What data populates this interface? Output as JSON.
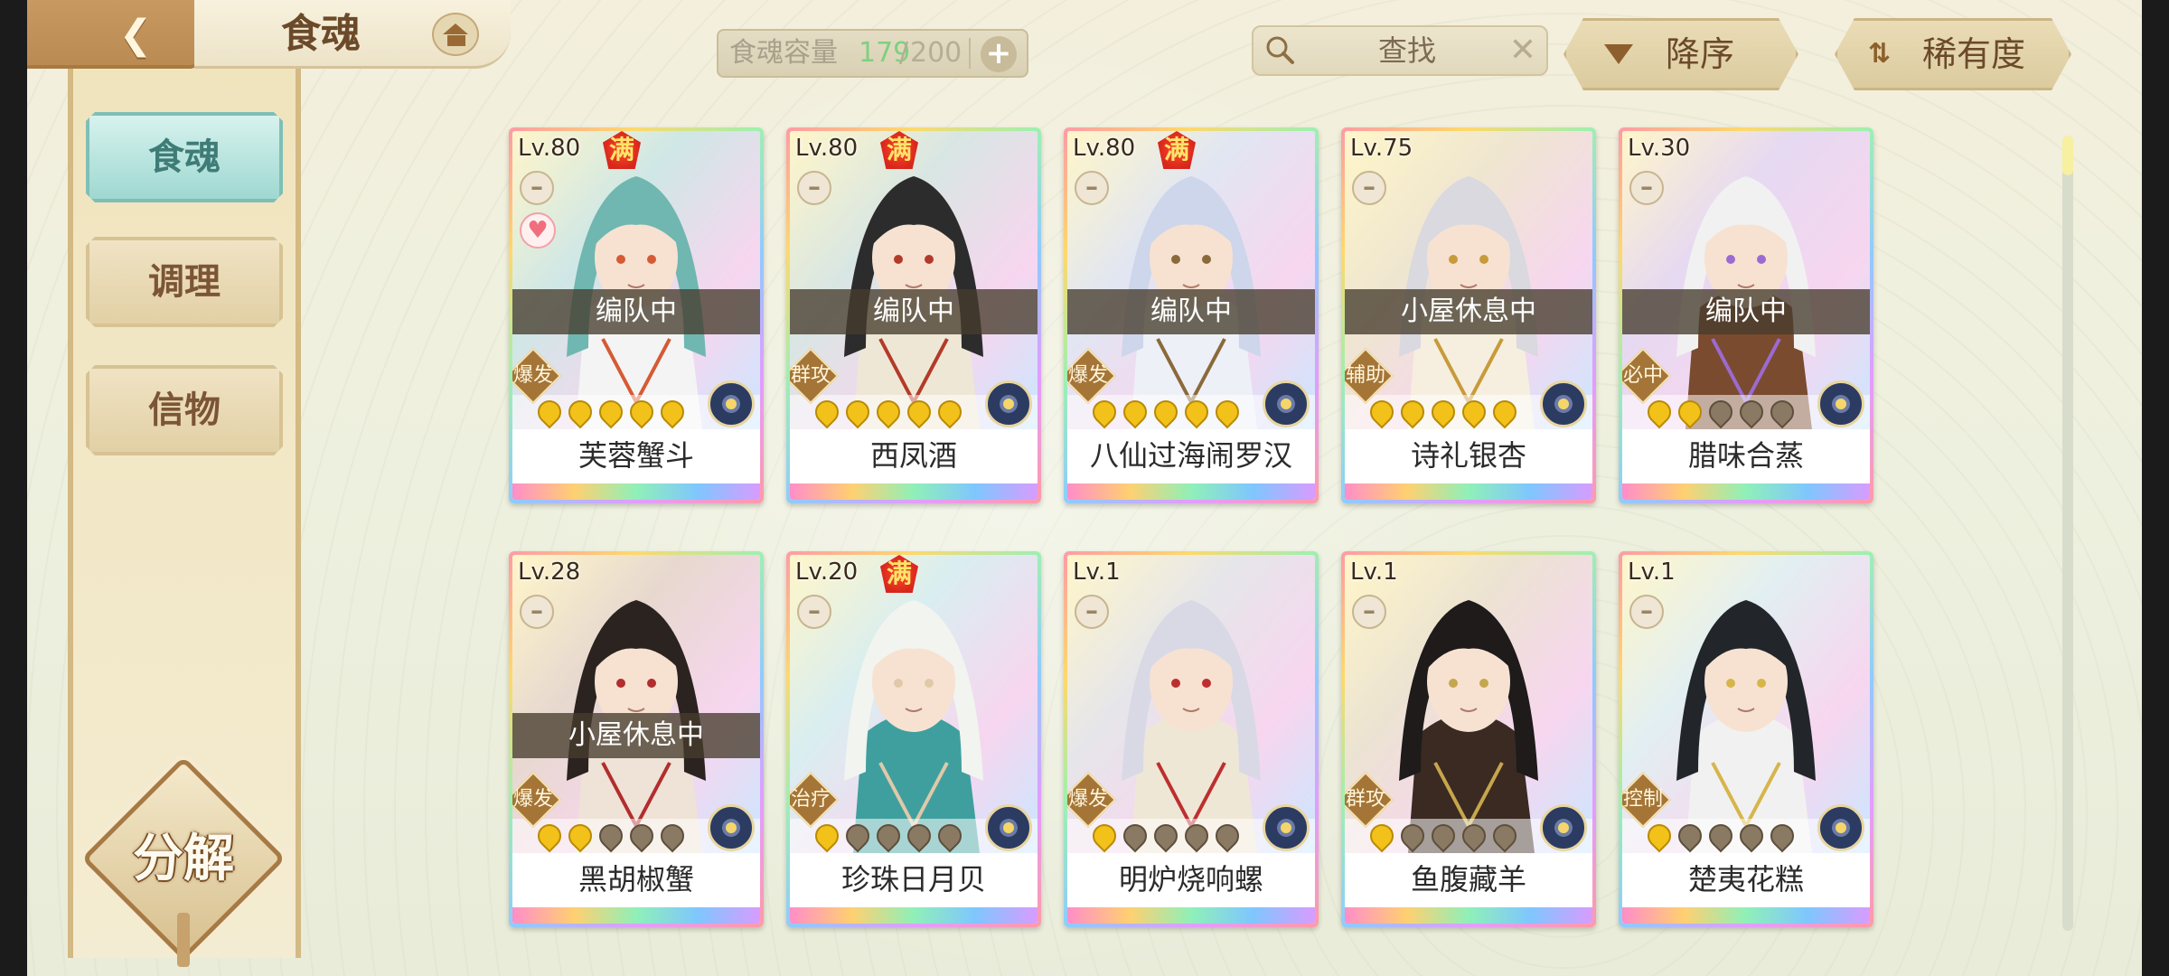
{
  "header": {
    "title": "食魂",
    "capacity": {
      "label": "食魂容量",
      "current": "179",
      "separator": "/",
      "max": "200"
    },
    "search": {
      "placeholder": "查找"
    },
    "sort_order": "降序",
    "sort_key": "稀有度"
  },
  "sidebar": {
    "items": [
      {
        "label": "食魂",
        "active": true
      },
      {
        "label": "调理",
        "active": false
      },
      {
        "label": "信物",
        "active": false
      }
    ],
    "decompose_label": "分解"
  },
  "colors": {
    "accent_teal": "#9fd8d1",
    "gold": "#a47537",
    "background": "#eef0df"
  },
  "cards": [
    {
      "level": "Lv.80",
      "full": "满",
      "status": "编队中",
      "role": "爆发",
      "stars": 5,
      "name": "芙蓉蟹斗",
      "favorite": true
    },
    {
      "level": "Lv.80",
      "full": "满",
      "status": "编队中",
      "role": "群攻",
      "stars": 5,
      "name": "西凤酒",
      "favorite": false
    },
    {
      "level": "Lv.80",
      "full": "满",
      "status": "编队中",
      "role": "爆发",
      "stars": 5,
      "name": "八仙过海闹罗汉",
      "favorite": false
    },
    {
      "level": "Lv.75",
      "full": "",
      "status": "小屋休息中",
      "role": "辅助",
      "stars": 5,
      "name": "诗礼银杏",
      "favorite": false
    },
    {
      "level": "Lv.30",
      "full": "",
      "status": "编队中",
      "role": "必中",
      "stars": 2,
      "name": "腊味合蒸",
      "favorite": false
    },
    {
      "level": "Lv.28",
      "full": "",
      "status": "小屋休息中",
      "role": "爆发",
      "stars": 2,
      "name": "黑胡椒蟹",
      "favorite": false
    },
    {
      "level": "Lv.20",
      "full": "满",
      "status": "",
      "role": "治疗",
      "stars": 1,
      "name": "珍珠日月贝",
      "favorite": false
    },
    {
      "level": "Lv.1",
      "full": "",
      "status": "",
      "role": "爆发",
      "stars": 1,
      "name": "明炉烧响螺",
      "favorite": false
    },
    {
      "level": "Lv.1",
      "full": "",
      "status": "",
      "role": "群攻",
      "stars": 1,
      "name": "鱼腹藏羊",
      "favorite": false
    },
    {
      "level": "Lv.1",
      "full": "",
      "status": "",
      "role": "控制",
      "stars": 1,
      "name": "楚夷花糕",
      "favorite": false
    }
  ]
}
